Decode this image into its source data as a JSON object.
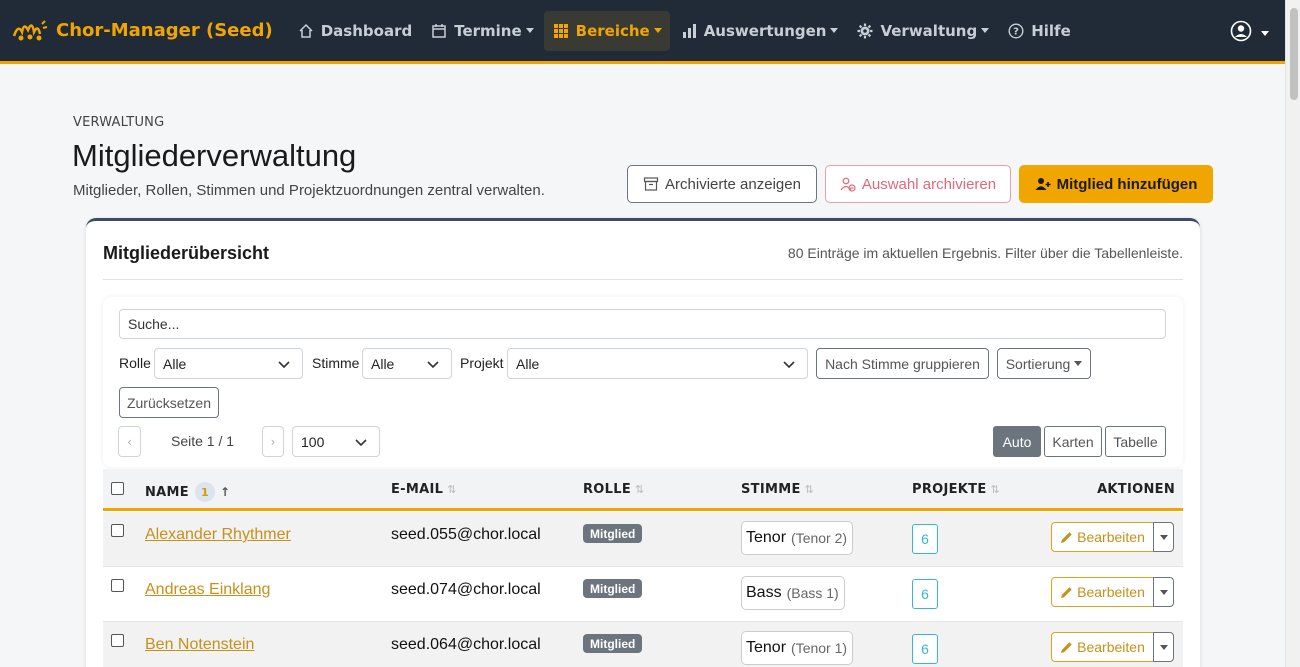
{
  "navbar": {
    "brand": "Chor-Manager (Seed)",
    "items": [
      {
        "label": "Dashboard",
        "icon": "home-icon",
        "dropdown": false,
        "active": false
      },
      {
        "label": "Termine",
        "icon": "calendar-icon",
        "dropdown": true,
        "active": false
      },
      {
        "label": "Bereiche",
        "icon": "grid-icon",
        "dropdown": true,
        "active": true
      },
      {
        "label": "Auswertungen",
        "icon": "bar-chart-icon",
        "dropdown": true,
        "active": false
      },
      {
        "label": "Verwaltung",
        "icon": "gear-icon",
        "dropdown": true,
        "active": false
      },
      {
        "label": "Hilfe",
        "icon": "help-icon",
        "dropdown": false,
        "active": false
      }
    ],
    "user_icon": "user-circle-icon"
  },
  "header": {
    "eyebrow": "VERWALTUNG",
    "title": "Mitgliederverwaltung",
    "subtitle": "Mitglieder, Rollen, Stimmen und Projektzuordnungen zentral verwalten.",
    "btn_archived": "Archivierte anzeigen",
    "btn_archive_selection": "Auswahl archivieren",
    "btn_add_member": "Mitglied hinzufügen"
  },
  "card": {
    "title": "Mitgliederübersicht",
    "meta": "80 Einträge im aktuellen Ergebnis. Filter über die Tabellenleiste."
  },
  "toolbar": {
    "search_placeholder": "Suche...",
    "role_label": "Rolle",
    "role_value": "Alle",
    "voice_label": "Stimme",
    "voice_value": "Alle",
    "project_label": "Projekt",
    "project_value": "Alle",
    "group_by_voice": "Nach Stimme gruppieren",
    "sort": "Sortierung",
    "reset": "Zurücksetzen",
    "prev": "‹",
    "next": "›",
    "page_info": "Seite 1 / 1",
    "page_size": "100",
    "view_auto": "Auto",
    "view_cards": "Karten",
    "view_table": "Tabelle"
  },
  "table": {
    "headers": {
      "name": "NAME",
      "name_sort_badge": "1",
      "email": "E-MAIL",
      "role": "ROLLE",
      "voice": "STIMME",
      "projects": "PROJEKTE",
      "actions": "AKTIONEN"
    },
    "edit_label": "Bearbeiten",
    "rows": [
      {
        "name": "Alexander Rhythmer",
        "email": "seed.055@chor.local",
        "role": "Mitglied",
        "voice": "Tenor",
        "voice_sub": "(Tenor 2)",
        "projects": "6"
      },
      {
        "name": "Andreas Einklang",
        "email": "seed.074@chor.local",
        "role": "Mitglied",
        "voice": "Bass",
        "voice_sub": "(Bass 1)",
        "projects": "6"
      },
      {
        "name": "Ben Notenstein",
        "email": "seed.064@chor.local",
        "role": "Mitglied",
        "voice": "Tenor",
        "voice_sub": "(Tenor 1)",
        "projects": "6"
      }
    ]
  },
  "colors": {
    "navbar_bg": "#212b38",
    "accent": "#f0a500",
    "link": "#c7901a",
    "info": "#38b6d0",
    "danger_outline": "#dc6a78"
  }
}
